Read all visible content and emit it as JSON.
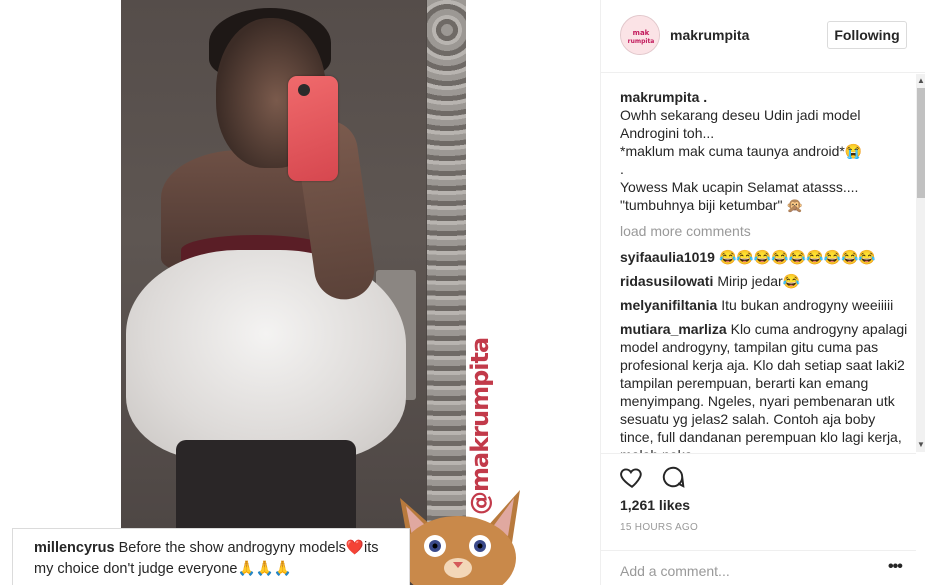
{
  "post": {
    "author": "makrumpita",
    "follow_label": "Following",
    "avatar_text": "mak rumpita",
    "watermark": "@makrumpita",
    "overlay_comment": {
      "user": "millencyrus",
      "text": "Before the show androgyny models❤️its my choice don't judge everyone🙏🙏🙏"
    }
  },
  "caption": {
    "user": "makrumpita .",
    "lines": [
      "Owhh sekarang deseu Udin jadi model",
      "Androgini toh...",
      "*maklum mak cuma taunya android*😭",
      ".",
      "Yowess Mak ucapin Selamat atasss....",
      "\"tumbuhnya biji ketumbar\" 🙊"
    ]
  },
  "load_more": "load more comments",
  "comments": [
    {
      "user": "syifaaulia1019",
      "text": "😂😂😂😂😂😂😂😂😂"
    },
    {
      "user": "ridasusilowati",
      "text": "Mirip jedar😂"
    },
    {
      "user": "melyanifiltania",
      "text": "Itu bukan androgyny weeiiiii"
    },
    {
      "user": "mutiara_marliza",
      "text": "Klo cuma androgyny apalagi model androgyny, tampilan gitu cuma pas profesional kerja aja. Klo dah setiap saat laki2 tampilan perempuan, berarti kan emang menyimpang. Ngeles, nyari pembenaran utk sesuatu yg jelas2 salah. Contoh aja boby tince, full dandanan perempuan klo lagi kerja, malah naka"
    }
  ],
  "likes": "1,261 likes",
  "timestamp": "15 HOURS AGO",
  "add_comment_placeholder": "Add a comment...",
  "icons": {
    "like": "heart-icon",
    "comment": "speech-bubble-icon",
    "more": "more-options-icon"
  }
}
